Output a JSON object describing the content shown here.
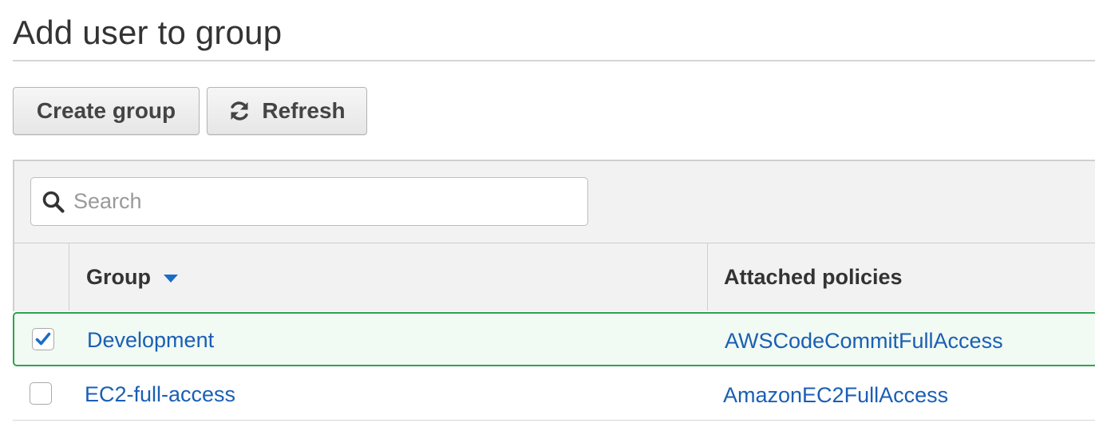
{
  "page": {
    "title": "Add user to group"
  },
  "toolbar": {
    "create_group_label": "Create group",
    "refresh_label": "Refresh",
    "refresh_icon": "refresh-icon"
  },
  "search": {
    "placeholder": "Search",
    "value": "",
    "icon": "search-icon"
  },
  "table": {
    "columns": {
      "group": "Group",
      "attached_policies": "Attached policies"
    },
    "sort": {
      "column": "group",
      "direction": "descending-indicator"
    },
    "rows": [
      {
        "checked": true,
        "group": "Development",
        "attached_policies": "AWSCodeCommitFullAccess"
      },
      {
        "checked": false,
        "group": "EC2-full-access",
        "attached_policies": "AmazonEC2FullAccess"
      }
    ]
  },
  "colors": {
    "link": "#1a5fb4",
    "selected_border": "#2ea44f",
    "checkmark": "#1a6cc7"
  }
}
